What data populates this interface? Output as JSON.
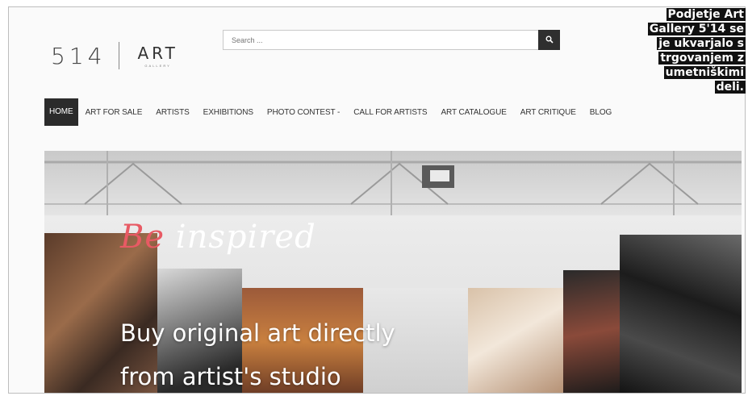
{
  "logo": {
    "number": "514",
    "word": "ART",
    "sub": "GALLERY"
  },
  "search": {
    "placeholder": "Search ..."
  },
  "caption": {
    "lines": [
      "Podjetje Art",
      "Gallery 5'14 se",
      "je ukvarjalo s",
      "trgovanjem z",
      "umetniškimi",
      "deli."
    ]
  },
  "nav": {
    "items": [
      {
        "label": "HOME",
        "active": true
      },
      {
        "label": "ART FOR SALE"
      },
      {
        "label": "ARTISTS"
      },
      {
        "label": "EXHIBITIONS"
      },
      {
        "label": "PHOTO CONTEST -"
      },
      {
        "label": "CALL FOR ARTISTS"
      },
      {
        "label": "ART CATALOGUE"
      },
      {
        "label": "ART CRITIQUE"
      },
      {
        "label": "BLOG"
      }
    ]
  },
  "hero": {
    "script_accent": "Be",
    "script_rest": " inspired",
    "headline_line1": "Buy original art directly",
    "headline_line2": "from artist's studio"
  },
  "colors": {
    "accent": "#e85a64",
    "nav_active_bg": "#2b2b2b",
    "search_button": "#2f2f2f"
  },
  "icons": {
    "search": "search-icon"
  }
}
